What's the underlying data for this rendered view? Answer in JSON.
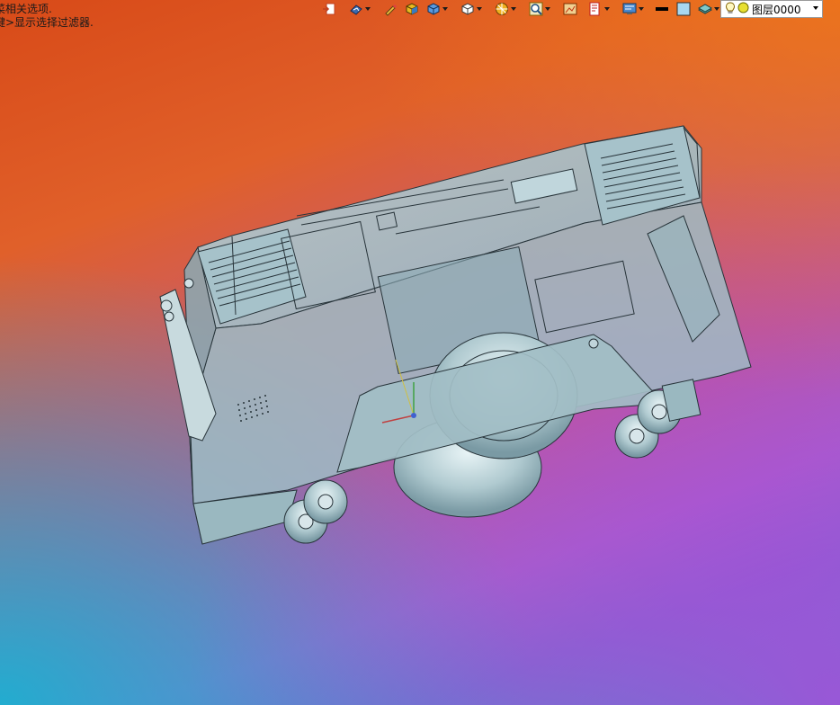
{
  "status": {
    "line1": "菜相关选项.",
    "line2": "键>显示选择过滤器."
  },
  "toolbar": {
    "icons": [
      "insert-part-icon",
      "view-orientation-icon",
      "pencil-icon",
      "shaded-box-icon",
      "display-style-icon",
      "section-cube-icon",
      "appearance-color-icon",
      "zoom-icon",
      "image-icon",
      "markup-icon",
      "monitor-icon",
      "line-style-icon",
      "fill-color-icon",
      "layer-stack-icon"
    ],
    "layer_label": "图层0000"
  },
  "colors": {
    "model_fill": "#a8c4cc",
    "model_stroke": "#2a3438",
    "model_dark": "#6e8a92",
    "wheel": "#b8d0d6"
  }
}
